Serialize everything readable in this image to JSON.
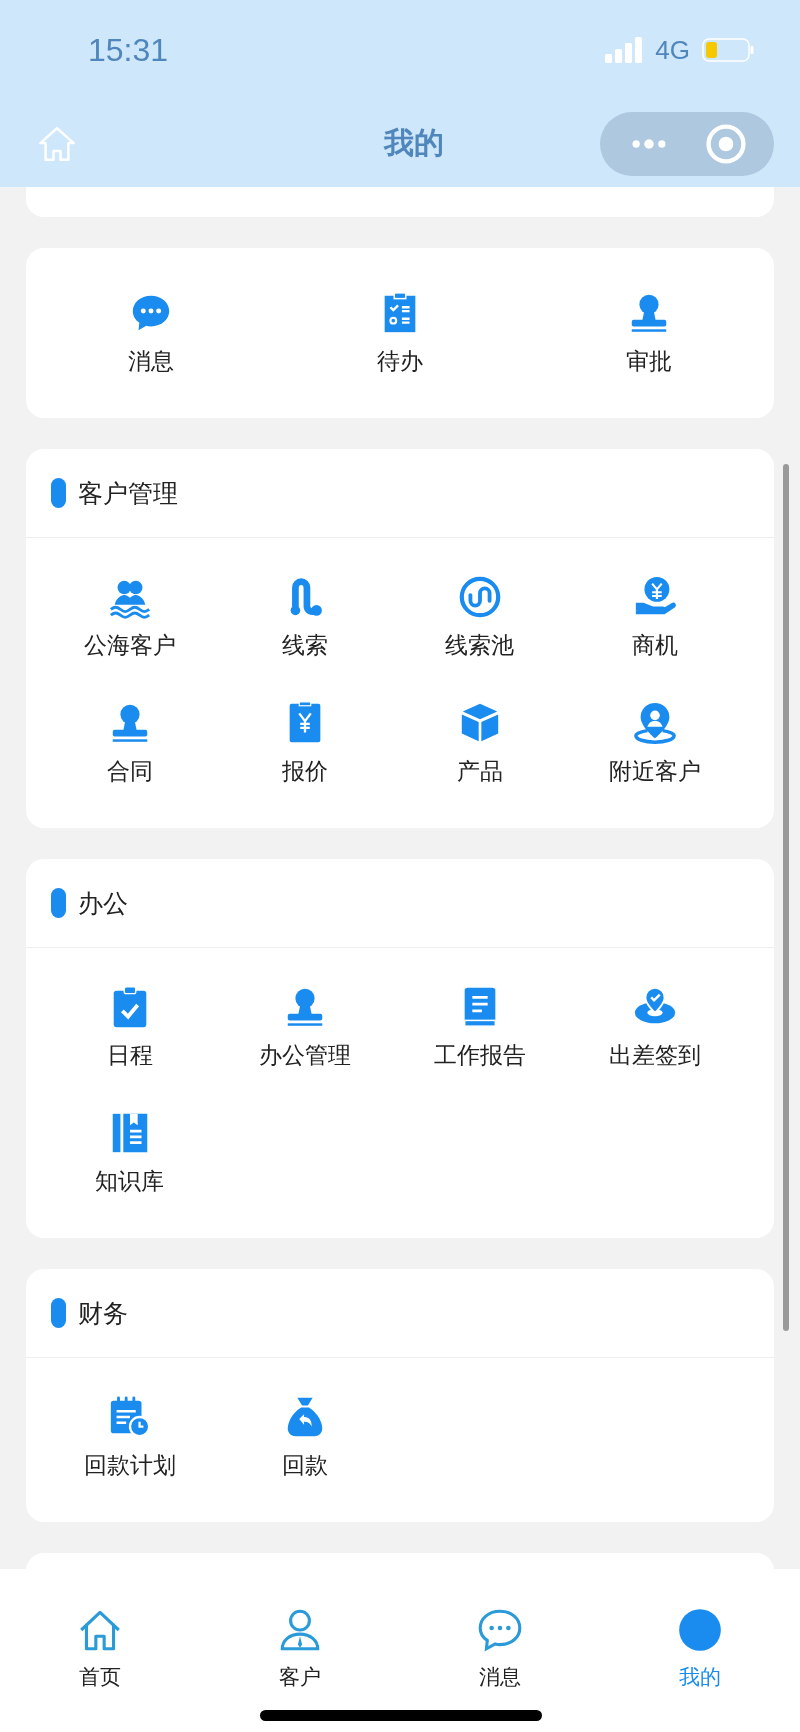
{
  "status_bar": {
    "time": "15:31",
    "network": "4G"
  },
  "nav_bar": {
    "title": "我的"
  },
  "quick_actions": [
    {
      "label": "消息"
    },
    {
      "label": "待办"
    },
    {
      "label": "审批"
    }
  ],
  "sections": [
    {
      "title": "客户管理",
      "items": [
        {
          "label": "公海客户"
        },
        {
          "label": "线索"
        },
        {
          "label": "线索池"
        },
        {
          "label": "商机"
        },
        {
          "label": "合同"
        },
        {
          "label": "报价"
        },
        {
          "label": "产品"
        },
        {
          "label": "附近客户"
        }
      ]
    },
    {
      "title": "办公",
      "items": [
        {
          "label": "日程"
        },
        {
          "label": "办公管理"
        },
        {
          "label": "工作报告"
        },
        {
          "label": "出差签到"
        },
        {
          "label": "知识库"
        }
      ]
    },
    {
      "title": "财务",
      "items": [
        {
          "label": "回款计划"
        },
        {
          "label": "回款"
        }
      ]
    }
  ],
  "tab_bar": [
    {
      "label": "首页",
      "selected": false
    },
    {
      "label": "客户",
      "selected": false
    },
    {
      "label": "消息",
      "selected": false
    },
    {
      "label": "我的",
      "selected": true
    }
  ]
}
